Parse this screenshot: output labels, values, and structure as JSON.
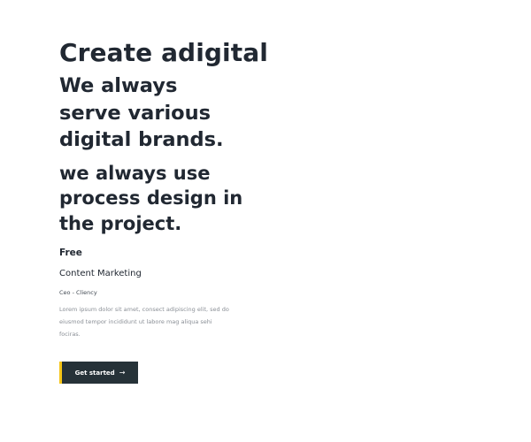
{
  "hero": {
    "title": "Create adigital",
    "subtitle": "We always serve various digital brands.",
    "tagline": "we always use process design in the project.",
    "free_label": "Free",
    "service_label": "Content Marketing",
    "role_label": "Ceo - Cliency",
    "description": "Lorem ipsum dolor sit amet, consect adipiscing elit, sed do eiusmod tempor incididunt ut labore mag aliqua sehi fociras."
  },
  "cta": {
    "label": "Get started",
    "icon": "arrow-right-icon",
    "accent_color": "#f5c518",
    "background_color": "#263238"
  }
}
